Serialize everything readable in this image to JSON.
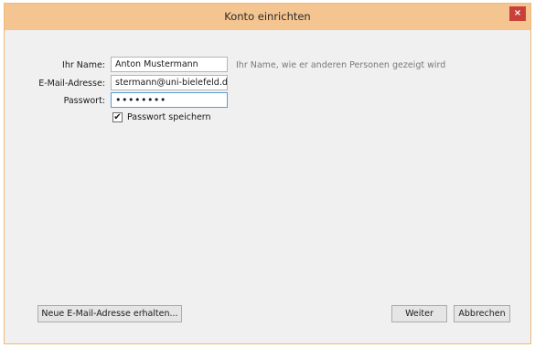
{
  "window": {
    "title": "Konto einrichten",
    "close_glyph": "×"
  },
  "form": {
    "name_label": "Ihr Name:",
    "name_value": "Anton Mustermann",
    "name_hint": "Ihr Name, wie er anderen Personen gezeigt wird",
    "email_label": "E-Mail-Adresse:",
    "email_value": "stermann@uni-bielefeld.de",
    "password_label": "Passwort:",
    "password_value": "••••••••",
    "remember_label": "Passwort speichern",
    "remember_checked": true,
    "checkmark": "✔"
  },
  "buttons": {
    "new_address": "Neue E-Mail-Adresse erhalten...",
    "next": "Weiter",
    "cancel": "Abbrechen"
  },
  "colors": {
    "titlebar": "#f4c590",
    "close": "#c9403a",
    "focus": "#5b9bd5"
  },
  "icons": {
    "close": "close-icon",
    "checkbox": "checkmark-icon"
  }
}
